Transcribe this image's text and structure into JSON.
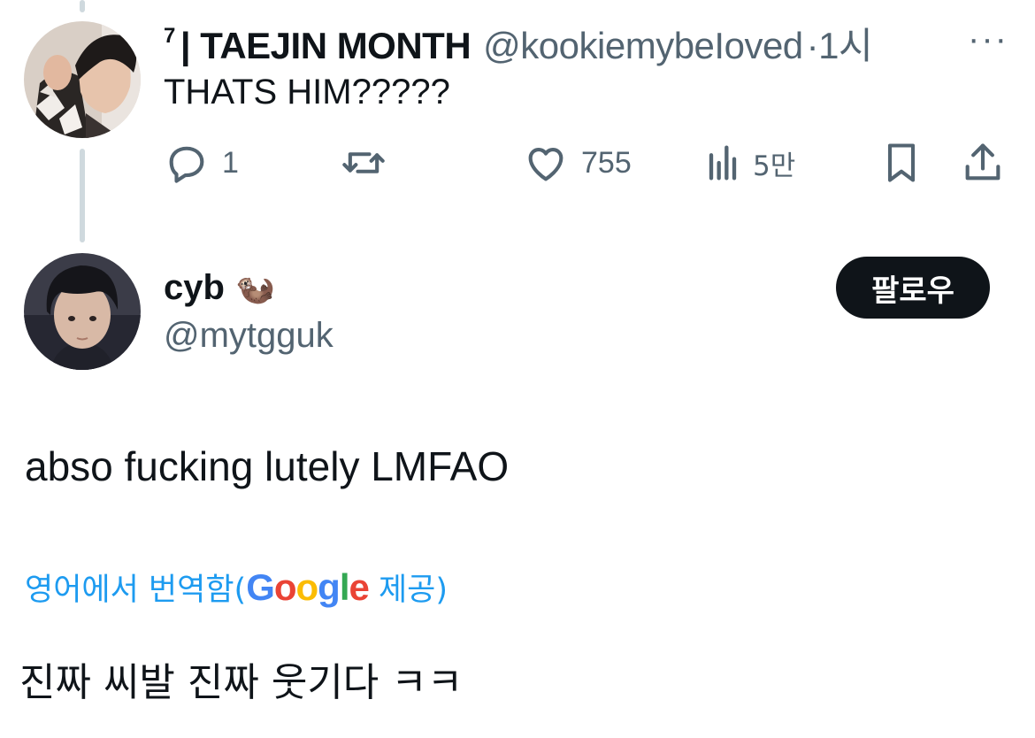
{
  "parent_tweet": {
    "author_sup": "7",
    "author_name": "| TAEJIN MONTH",
    "author_handle": "@kookiemybeIoved",
    "timestamp": "·1시",
    "more_label": "···",
    "text": "THATS HIM?????",
    "actions": {
      "replies": "1",
      "likes": "755",
      "views": "5만"
    }
  },
  "reply_tweet": {
    "author_name": "cyb",
    "author_emoji": "🦦",
    "author_handle": "@mytgguk",
    "follow_label": "팔로우",
    "text": "abso fucking lutely LMFAO",
    "translate": {
      "prefix": "영어에서 번역함(",
      "google": [
        "G",
        "o",
        "o",
        "g",
        "l",
        "e"
      ],
      "google_colors": [
        "#4285F4",
        "#EA4335",
        "#FBBC05",
        "#4285F4",
        "#34A853",
        "#EA4335"
      ],
      "suffix": " 제공)"
    },
    "translated_text": "진짜 씨발 진짜 웃기다 ㅋㅋ"
  },
  "colors": {
    "text_primary": "#0f1419",
    "text_secondary": "#536471",
    "link": "#1d9bf0",
    "thread_line": "#cfd9de"
  }
}
